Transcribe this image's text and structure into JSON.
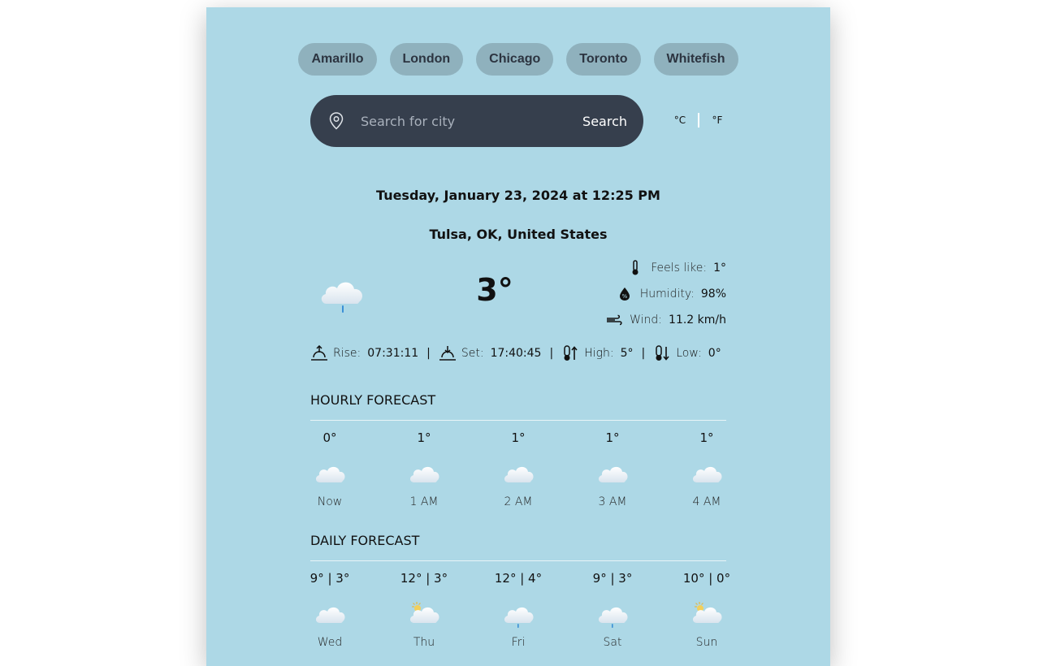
{
  "cities": [
    "Amarillo",
    "London",
    "Chicago",
    "Toronto",
    "Whitefish"
  ],
  "search": {
    "placeholder": "Search for city",
    "button": "Search"
  },
  "units": {
    "celsius": "°C",
    "fahrenheit": "°F"
  },
  "date_time": "Tuesday, January 23, 2024 at 12:25 PM",
  "location": "Tulsa, OK, United States",
  "current": {
    "temp": "3°",
    "condition_icon": "cloud-rain-icon",
    "feels_like_label": "Feels like:",
    "feels_like": "1°",
    "humidity_label": "Humidity:",
    "humidity": "98%",
    "wind_label": "Wind:",
    "wind": "11.2 km/h"
  },
  "sun": {
    "rise_label": "Rise:",
    "rise": "07:31:11",
    "set_label": "Set:",
    "set": "17:40:45",
    "high_label": "High:",
    "high": "5°",
    "low_label": "Low:",
    "low": "0°",
    "separator": "|"
  },
  "hourly": {
    "title": "HOURLY FORECAST",
    "items": [
      {
        "temp": "0°",
        "label": "Now",
        "icon": "cloud-icon"
      },
      {
        "temp": "1°",
        "label": "1 AM",
        "icon": "cloud-icon"
      },
      {
        "temp": "1°",
        "label": "2 AM",
        "icon": "cloud-icon"
      },
      {
        "temp": "1°",
        "label": "3 AM",
        "icon": "cloud-icon"
      },
      {
        "temp": "1°",
        "label": "4 AM",
        "icon": "cloud-icon"
      }
    ]
  },
  "daily": {
    "title": "DAILY FORECAST",
    "items": [
      {
        "temp": "9° | 3°",
        "label": "Wed",
        "icon": "cloud-icon"
      },
      {
        "temp": "12° | 3°",
        "label": "Thu",
        "icon": "partly-cloudy-icon"
      },
      {
        "temp": "12° | 4°",
        "label": "Fri",
        "icon": "cloud-rain-icon"
      },
      {
        "temp": "9° | 3°",
        "label": "Sat",
        "icon": "cloud-rain-icon"
      },
      {
        "temp": "10° | 0°",
        "label": "Sun",
        "icon": "partly-cloudy-icon"
      }
    ]
  },
  "colors": {
    "background": "#add8e6",
    "chip": "#8fb1bd",
    "search_bar": "#363f4d"
  }
}
